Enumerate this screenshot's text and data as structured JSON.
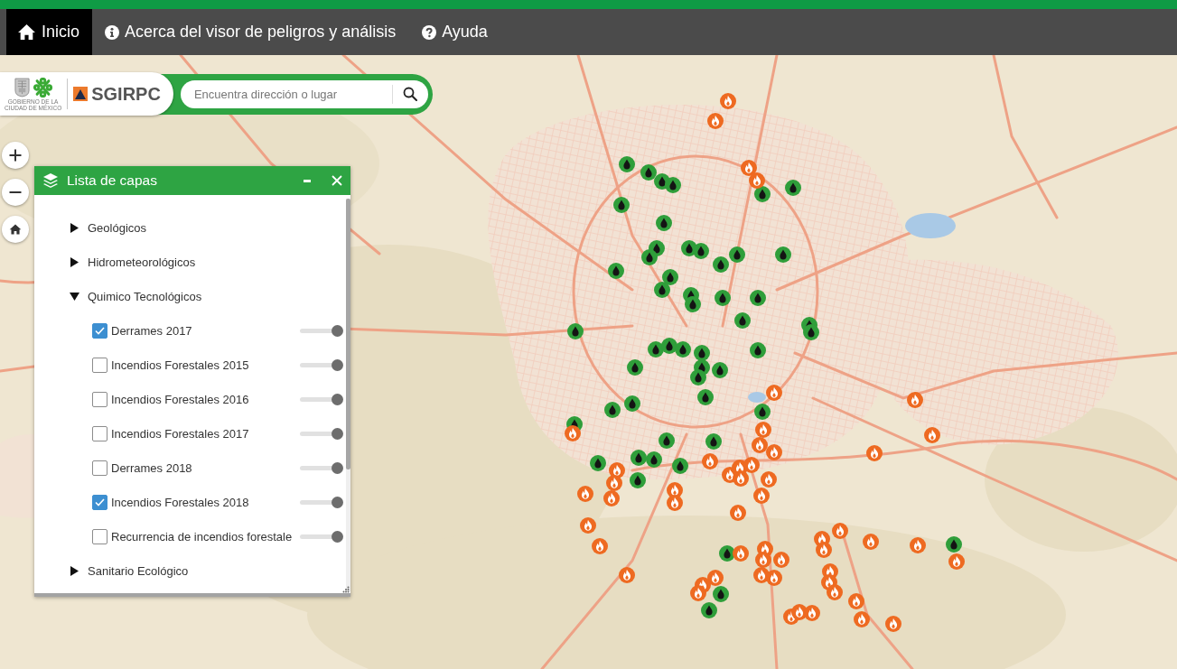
{
  "nav": {
    "items": [
      {
        "label": "Inicio",
        "selected": true
      },
      {
        "label": "Acerca del visor de peligros y análisis",
        "selected": false
      },
      {
        "label": "Ayuda",
        "selected": false
      }
    ]
  },
  "logo": {
    "caption": [
      "GOBIERNO DE LA",
      "CIUDAD DE MÉXICO"
    ],
    "name": "SGIRPC"
  },
  "search": {
    "placeholder": "Encuentra dirección o lugar"
  },
  "layer_panel": {
    "title": "Lista de capas",
    "groups": [
      {
        "label": "Geológicos",
        "expanded": false
      },
      {
        "label": "Hidrometeorológicos",
        "expanded": false
      },
      {
        "label": "Quimico Tecnológicos",
        "expanded": true,
        "children": [
          {
            "label": "Derrames 2017",
            "checked": true,
            "level": 1
          },
          {
            "label": "Incendios Forestales 2015",
            "checked": false,
            "level": 1
          },
          {
            "label": "Incendios Forestales 2016",
            "checked": false,
            "level": 1
          },
          {
            "label": "Incendios Forestales 2017",
            "checked": false,
            "level": 1
          },
          {
            "label": "Derrames 2018",
            "checked": false,
            "level": 1
          },
          {
            "label": "Incendios Forestales 2018",
            "checked": true,
            "level": 1
          },
          {
            "label": "Recurrencia de incendios forestale",
            "checked": false,
            "level": 1
          }
        ]
      },
      {
        "label": "Sanitario Ecológico",
        "expanded": false
      }
    ]
  }
}
